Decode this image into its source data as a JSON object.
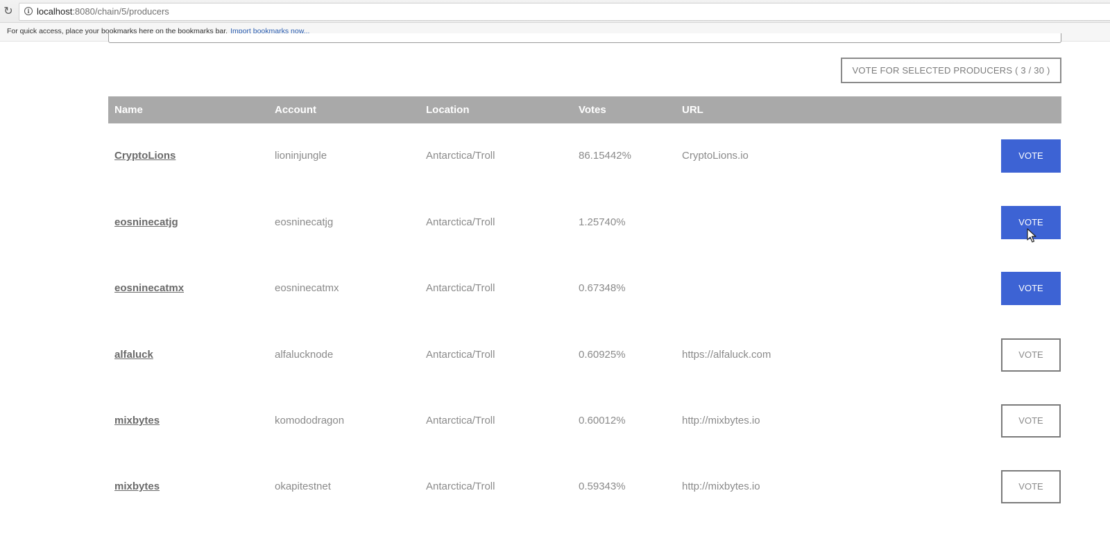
{
  "browser": {
    "url_host": "localhost",
    "url_path": ":8080/chain/5/producers",
    "bookmarks_message": "For quick access, place your bookmarks here on the bookmarks bar.",
    "bookmarks_link": "Import bookmarks now..."
  },
  "toolbar": {
    "vote_selected_label": "VOTE FOR SELECTED PRODUCERS ( 3 / 30 )"
  },
  "table": {
    "headers": {
      "name": "Name",
      "account": "Account",
      "location": "Location",
      "votes": "Votes",
      "url": "URL"
    },
    "rows": [
      {
        "name": "CryptoLions",
        "account": "lioninjungle",
        "location": "Antarctica/Troll",
        "votes": "86.15442%",
        "url": "CryptoLions.io",
        "vote_label": "VOTE",
        "selected": true
      },
      {
        "name": "eosninecatjg",
        "account": "eosninecatjg",
        "location": "Antarctica/Troll",
        "votes": "1.25740%",
        "url": "",
        "vote_label": "VOTE",
        "selected": true
      },
      {
        "name": "eosninecatmx",
        "account": "eosninecatmx",
        "location": "Antarctica/Troll",
        "votes": "0.67348%",
        "url": "",
        "vote_label": "VOTE",
        "selected": true
      },
      {
        "name": "alfaluck",
        "account": "alfalucknode",
        "location": "Antarctica/Troll",
        "votes": "0.60925%",
        "url": "https://alfaluck.com",
        "vote_label": "VOTE",
        "selected": false
      },
      {
        "name": "mixbytes",
        "account": "komododragon",
        "location": "Antarctica/Troll",
        "votes": "0.60012%",
        "url": "http://mixbytes.io",
        "vote_label": "VOTE",
        "selected": false
      },
      {
        "name": "mixbytes",
        "account": "okapitestnet",
        "location": "Antarctica/Troll",
        "votes": "0.59343%",
        "url": "http://mixbytes.io",
        "vote_label": "VOTE",
        "selected": false
      }
    ]
  },
  "colors": {
    "accent": "#3d63d4",
    "header_bg": "#a9a9a9"
  }
}
